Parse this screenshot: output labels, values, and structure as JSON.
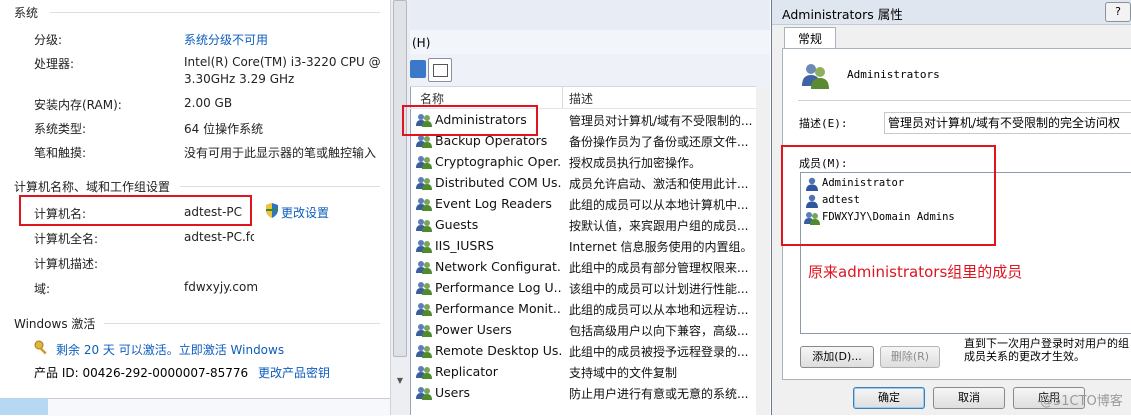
{
  "system": {
    "section_system": "系统",
    "rating_label": "分级:",
    "rating_value": "系统分级不可用",
    "cpu_label": "处理器:",
    "cpu_value_1": "Intel(R) Core(TM) i3-3220 CPU @",
    "cpu_value_2": "3.30GHz   3.29 GHz",
    "ram_label": "安装内存(RAM):",
    "ram_value": "2.00 GB",
    "type_label": "系统类型:",
    "type_value": "64 位操作系统",
    "pen_label": "笔和触摸:",
    "pen_value": "没有可用于此显示器的笔或触控输入",
    "section_name": "计算机名称、域和工作组设置",
    "computer_name_label": "计算机名:",
    "computer_name_value": "adtest-PC",
    "change_settings": "更改设置",
    "full_name_label": "计算机全名:",
    "full_name_value": "adtest-PC.fd",
    "desc_label": "计算机描述:",
    "domain_label": "域:",
    "domain_value": "fdwxyjy.com",
    "section_activation": "Windows 激活",
    "activation_text": "剩余 20 天 可以激活。立即激活 Windows",
    "product_id": "产品 ID: 00426-292-0000007-85776",
    "change_key": "更改产品密钥"
  },
  "groups": {
    "menu_fragment": "(H)",
    "col_name": "名称",
    "col_desc": "描述",
    "rows": [
      {
        "name": "Administrators",
        "desc": "管理员对计算机/域有不受限制的..."
      },
      {
        "name": "Backup Operators",
        "desc": "备份操作员为了备份或还原文件..."
      },
      {
        "name": "Cryptographic Oper...",
        "desc": "授权成员执行加密操作。"
      },
      {
        "name": "Distributed COM Us...",
        "desc": "成员允许启动、激活和使用此计..."
      },
      {
        "name": "Event Log Readers",
        "desc": "此组的成员可以从本地计算机中..."
      },
      {
        "name": "Guests",
        "desc": "按默认值，来宾跟用户组的成员..."
      },
      {
        "name": "IIS_IUSRS",
        "desc": "Internet 信息服务使用的内置组。"
      },
      {
        "name": "Network Configurat...",
        "desc": "此组中的成员有部分管理权限来..."
      },
      {
        "name": "Performance Log U...",
        "desc": "该组中的成员可以计划进行性能..."
      },
      {
        "name": "Performance Monit...",
        "desc": "此组的成员可以从本地和远程访..."
      },
      {
        "name": "Power Users",
        "desc": "包括高级用户以向下兼容，高级..."
      },
      {
        "name": "Remote Desktop Us...",
        "desc": "此组中的成员被授予远程登录的..."
      },
      {
        "name": "Replicator",
        "desc": "支持域中的文件复制"
      },
      {
        "name": "Users",
        "desc": "防止用户进行有意或无意的系统..."
      }
    ]
  },
  "dialog": {
    "title": "Administrators 属性",
    "help": "?",
    "tab_general": "常规",
    "group_name": "Administrators",
    "desc_label": "描述(E):",
    "desc_value": "管理员对计算机/域有不受限制的完全访问权",
    "members_label": "成员(M):",
    "members": [
      "Administrator",
      "adtest",
      "FDWXYJY\\Domain Admins"
    ],
    "annotation": "原来administrators组里的成员",
    "note": "直到下一次用户登录时对用户的组成员关系的更改才生效。",
    "add_button": "添加(D)...",
    "remove_button": "删除(R)",
    "ok_button": "确定",
    "cancel_button": "取消",
    "apply_button": "应用",
    "watermark": "@51CTO博客"
  }
}
